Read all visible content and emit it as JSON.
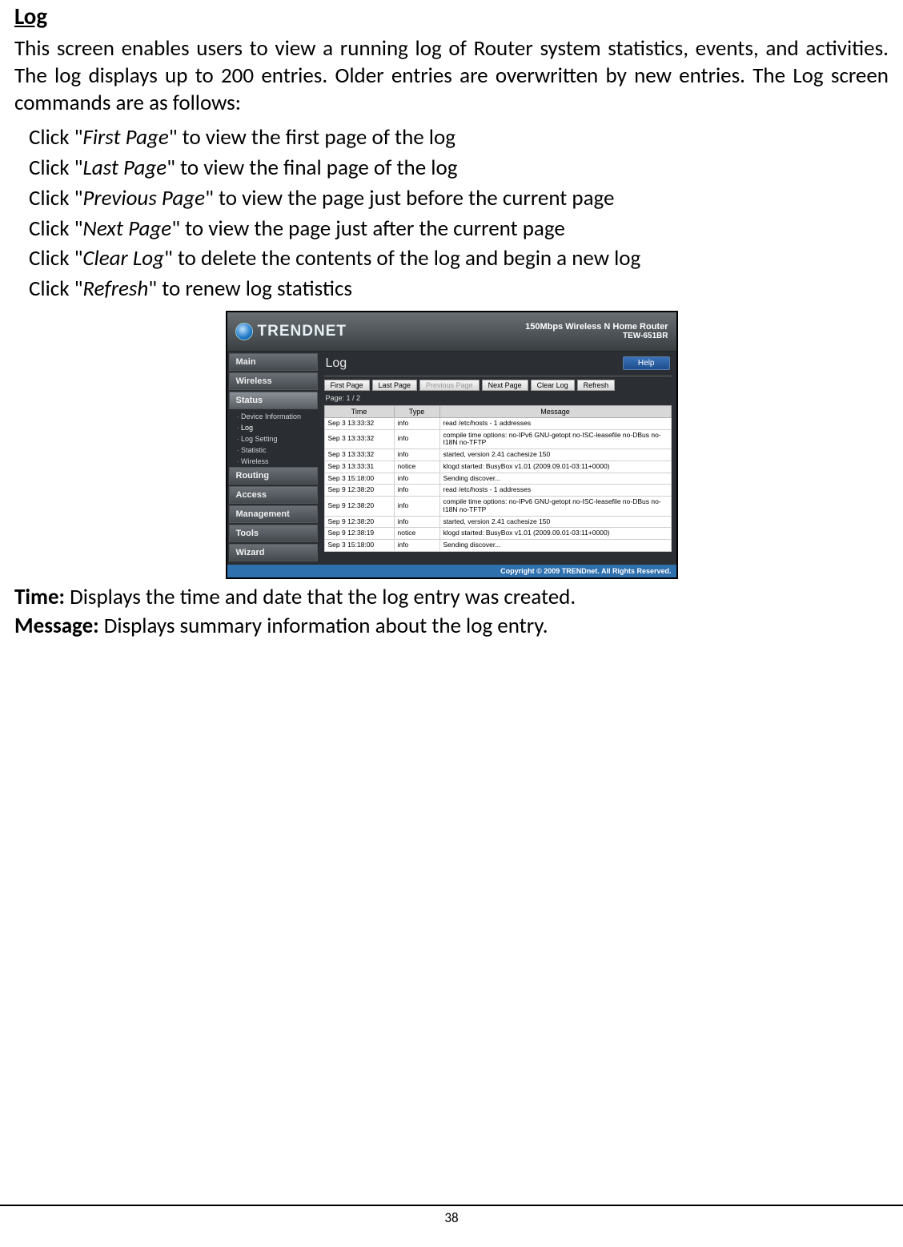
{
  "section_title": "Log",
  "intro": "This screen enables users to view a running log of Router system statistics, events, and activities. The log displays up to 200 entries. Older entries are overwritten by new entries. The Log screen commands are as follows:",
  "commands": [
    {
      "pre": "Click \"",
      "em": "First Page",
      "post": "\" to view the first page of the log"
    },
    {
      "pre": "Click \"",
      "em": "Last Page",
      "post": "\" to view the final page of the log"
    },
    {
      "pre": "Click \"",
      "em": "Previous Page",
      "post": "\" to view the page just before the current page"
    },
    {
      "pre": "Click \"",
      "em": "Next Page",
      "post": "\" to view the page just after the current page"
    },
    {
      "pre": "Click \"",
      "em": "Clear Log",
      "post": "\" to delete the contents of the log and begin a new log"
    },
    {
      "pre": "Click \"",
      "em": "Refresh",
      "post": "\" to renew log statistics"
    }
  ],
  "router": {
    "brand": "TRENDNET",
    "model_line1": "150Mbps Wireless N Home Router",
    "model_line2": "TEW-651BR",
    "nav": [
      "Main",
      "Wireless",
      "Status",
      "Routing",
      "Access",
      "Management",
      "Tools",
      "Wizard"
    ],
    "subnav": [
      "Device Information",
      "Log",
      "Log Setting",
      "Statistic",
      "Wireless"
    ],
    "content_title": "Log",
    "help": "Help",
    "buttons": [
      "First Page",
      "Last Page",
      "Previous Page",
      "Next Page",
      "Clear Log",
      "Refresh"
    ],
    "page_label": "Page: 1 / 2",
    "columns": [
      "Time",
      "Type",
      "Message"
    ],
    "rows": [
      {
        "t": "Sep 3 13:33:32",
        "y": "info",
        "m": "read /etc/hosts - 1 addresses"
      },
      {
        "t": "Sep 3 13:33:32",
        "y": "info",
        "m": "compile time options: no-IPv6 GNU-getopt no-ISC-leasefile no-DBus no-I18N no-TFTP"
      },
      {
        "t": "Sep 3 13:33:32",
        "y": "info",
        "m": "started, version 2.41 cachesize 150"
      },
      {
        "t": "Sep 3 13:33:31",
        "y": "notice",
        "m": "klogd started: BusyBox v1.01 (2009.09.01-03:11+0000)"
      },
      {
        "t": "Sep 3 15:18:00",
        "y": "info",
        "m": "Sending discover..."
      },
      {
        "t": "Sep 9 12:38:20",
        "y": "info",
        "m": "read /etc/hosts - 1 addresses"
      },
      {
        "t": "Sep 9 12:38:20",
        "y": "info",
        "m": "compile time options: no-IPv6 GNU-getopt no-ISC-leasefile no-DBus no-I18N no-TFTP"
      },
      {
        "t": "Sep 9 12:38:20",
        "y": "info",
        "m": "started, version 2.41 cachesize 150"
      },
      {
        "t": "Sep 9 12:38:19",
        "y": "notice",
        "m": "klogd started: BusyBox v1.01 (2009.09.01-03:11+0000)"
      },
      {
        "t": "Sep 3 15:18:00",
        "y": "info",
        "m": "Sending discover..."
      }
    ],
    "footer": "Copyright © 2009 TRENDnet. All Rights Reserved."
  },
  "fields": [
    {
      "label": "Time:",
      "text": " Displays the time and date that the log entry was created."
    },
    {
      "label": "Message:",
      "text": " Displays summary information about the log entry."
    }
  ],
  "page_number": "38"
}
